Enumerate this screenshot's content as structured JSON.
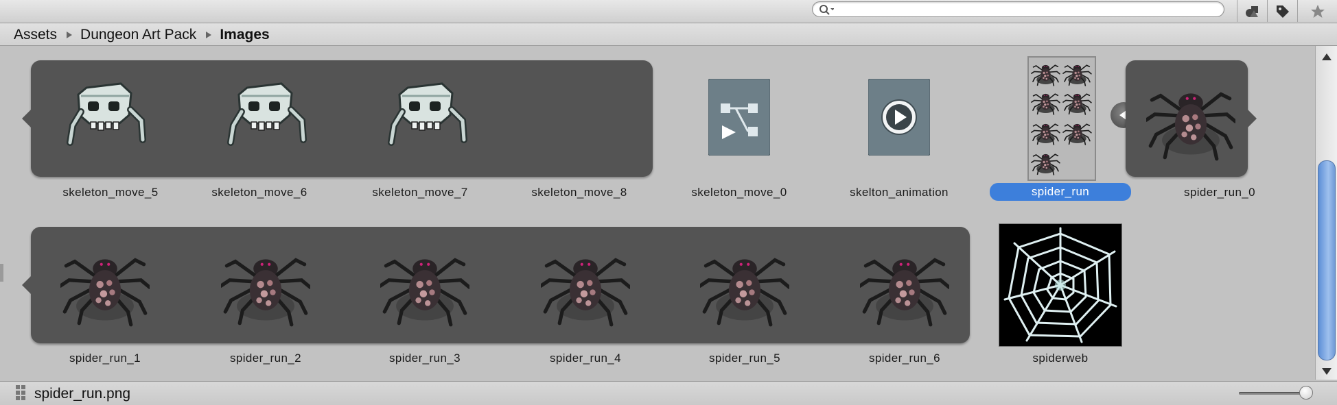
{
  "breadcrumb": {
    "items": [
      "Assets",
      "Dungeon Art Pack"
    ],
    "current": "Images"
  },
  "search": {
    "placeholder": "",
    "value": ""
  },
  "toolbar": {
    "icons": [
      "filter-by-type-icon",
      "filter-by-label-icon",
      "favorites-star-icon"
    ]
  },
  "assets": {
    "skeleton_move_5": "skeleton_move_5",
    "skeleton_move_6": "skeleton_move_6",
    "skeleton_move_7": "skeleton_move_7",
    "skeleton_move_8": "skeleton_move_8",
    "skeleton_move_0": "skeleton_move_0",
    "skelton_animation": "skelton_animation",
    "spider_run": "spider_run",
    "spider_run_0": "spider_run_0",
    "spider_run_1": "spider_run_1",
    "spider_run_2": "spider_run_2",
    "spider_run_3": "spider_run_3",
    "spider_run_4": "spider_run_4",
    "spider_run_5": "spider_run_5",
    "spider_run_6": "spider_run_6",
    "spiderweb": "spiderweb"
  },
  "selected_asset": "spider_run",
  "status": {
    "filename": "spider_run.png"
  },
  "colors": {
    "selection": "#3d7fdb",
    "group_bg": "#545454",
    "window_bg": "#c2c2c2"
  }
}
